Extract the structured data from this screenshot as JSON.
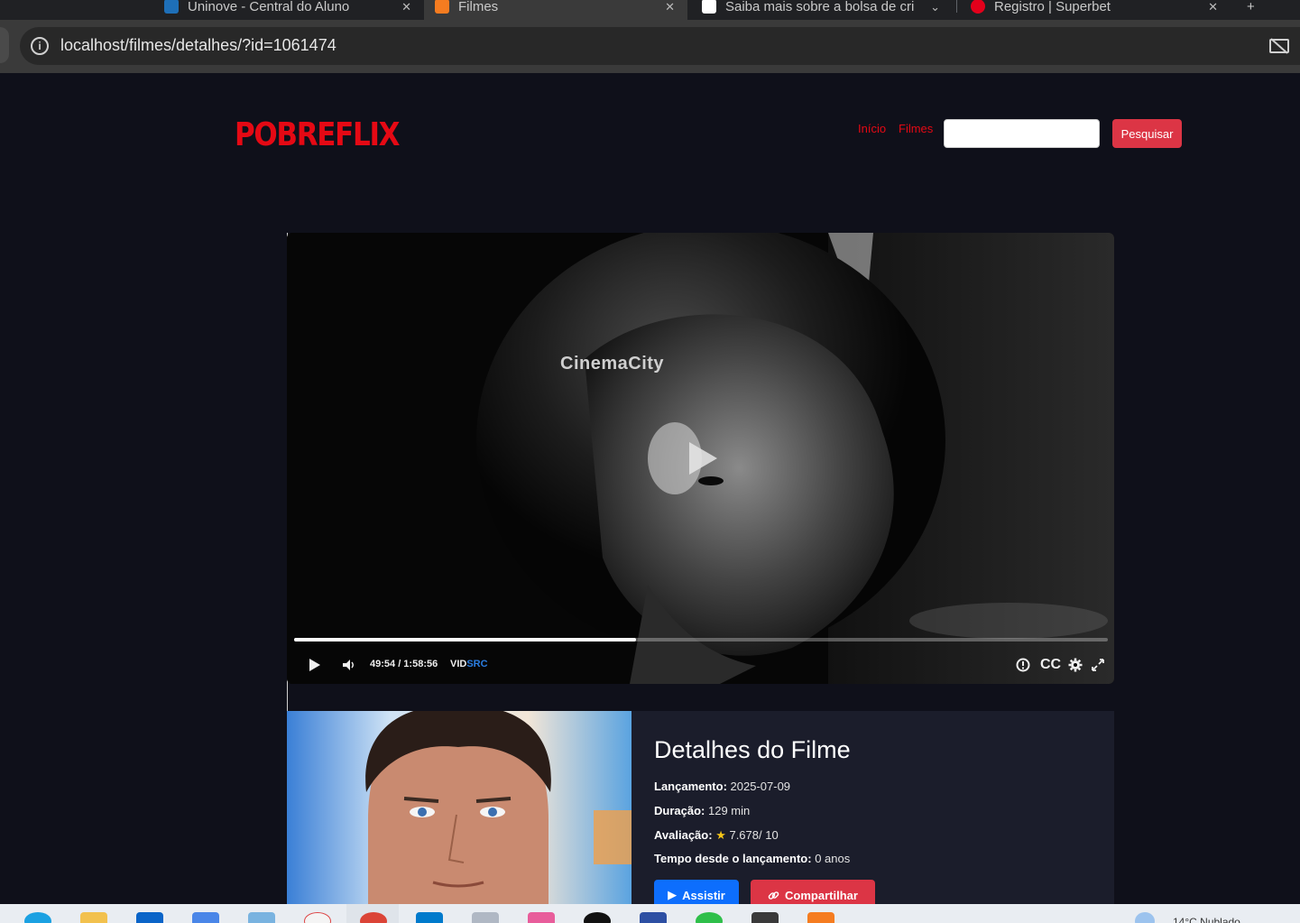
{
  "browser": {
    "tabs": [
      {
        "label": "Uninove - Central do Aluno",
        "active": false
      },
      {
        "label": "Filmes",
        "active": true
      },
      {
        "label": "Saiba mais sobre a bolsa de cri",
        "active": false
      },
      {
        "label": "Registro | Superbet",
        "active": false
      }
    ],
    "url": "localhost/filmes/detalhes/?id=1061474"
  },
  "header": {
    "logo": "POBREFLIX",
    "nav": [
      "Início",
      "Filmes"
    ],
    "search_placeholder": "",
    "search_button": "Pesquisar"
  },
  "player": {
    "watermark": "CinemaCity",
    "current_time": "49:54",
    "duration": "1:58:56",
    "time_display": "49:54 / 1:58:56",
    "brand_main": "VID",
    "brand_accent": "SRC",
    "cc_label": "CC",
    "progress": 0.42
  },
  "details": {
    "title": "Detalhes do Filme",
    "release_label": "Lançamento:",
    "release_value": "2025-07-09",
    "duration_label": "Duração:",
    "duration_value": "129 min",
    "rating_label": "Avaliação:",
    "rating_star": "★",
    "rating_value": "7.678/ 10",
    "since_label": "Tempo desde o lançamento:",
    "since_value": "0 anos",
    "watch_button": "Assistir",
    "share_button": "Compartilhar"
  },
  "taskbar": {
    "weather_text": "14°C Nublado"
  },
  "colors": {
    "brand_red": "#e50914",
    "page_bg": "#0f101a",
    "panel_bg": "#1b1d2b",
    "watch_blue": "#0d6efd",
    "share_red": "#dc3545"
  }
}
